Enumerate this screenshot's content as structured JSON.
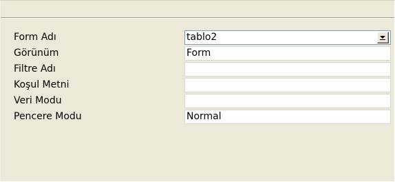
{
  "properties": [
    {
      "label": "Form Adı",
      "value": "tablo2"
    },
    {
      "label": "Görünüm",
      "value": "Form"
    },
    {
      "label": "Filtre Adı",
      "value": ""
    },
    {
      "label": "Koşul Metni",
      "value": ""
    },
    {
      "label": "Veri Modu",
      "value": ""
    },
    {
      "label": "Pencere Modu",
      "value": "Normal"
    }
  ],
  "icons": {
    "dropdown": "chevron-down-icon"
  },
  "colors": {
    "panel_bg": "#ece9d8",
    "field_bg": "#ffffff",
    "combo_border": "#7f9db9"
  }
}
